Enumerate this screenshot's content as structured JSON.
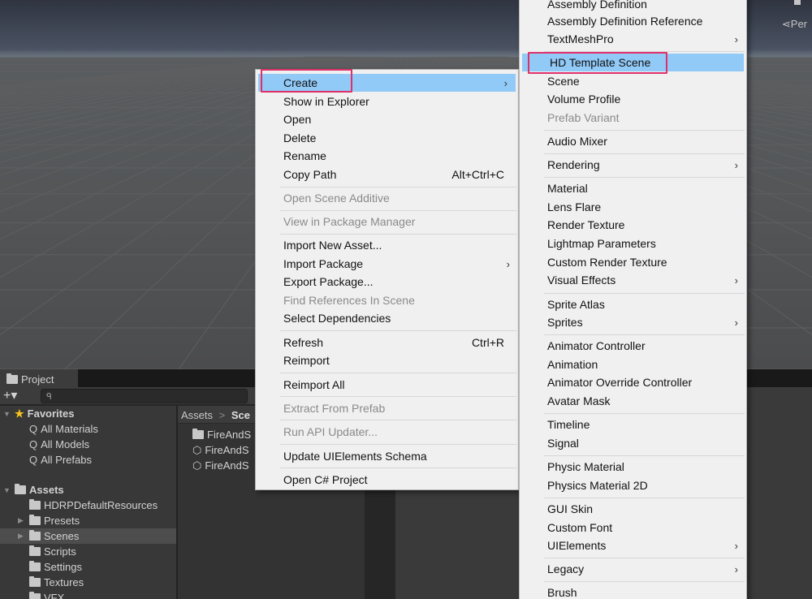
{
  "scene": {
    "persp_label": "⋖Per",
    "colors": {
      "sky": "#4a5262",
      "ground": "#4b4c4d",
      "grid": "#5e5f60"
    }
  },
  "project": {
    "tab_label": "Project",
    "add_button": "+▾",
    "search_placeholder": "",
    "favorites": {
      "label": "Favorites",
      "items": [
        "All Materials",
        "All Models",
        "All Prefabs"
      ]
    },
    "assets": {
      "label": "Assets",
      "items": [
        {
          "label": "HDRPDefaultResources",
          "expandable": false,
          "selected": false
        },
        {
          "label": "Presets",
          "expandable": true,
          "selected": false
        },
        {
          "label": "Scenes",
          "expandable": true,
          "selected": true
        },
        {
          "label": "Scripts",
          "expandable": false,
          "selected": false
        },
        {
          "label": "Settings",
          "expandable": false,
          "selected": false
        },
        {
          "label": "Textures",
          "expandable": false,
          "selected": false
        },
        {
          "label": "VFX",
          "expandable": false,
          "selected": false
        }
      ]
    },
    "breadcrumb": {
      "root": "Assets",
      "sep": ">",
      "current": "Sce"
    },
    "files": [
      {
        "icon": "folder-icon",
        "label": "FireAndS"
      },
      {
        "icon": "unity-scene-icon",
        "label": "FireAndS"
      },
      {
        "icon": "unity-scene-icon",
        "label": "FireAndS"
      }
    ]
  },
  "context_menu": {
    "items": [
      {
        "label": "Create",
        "highlighted": true,
        "submenu": true
      },
      {
        "label": "Show in Explorer"
      },
      {
        "label": "Open"
      },
      {
        "label": "Delete"
      },
      {
        "label": "Rename"
      },
      {
        "label": "Copy Path",
        "shortcut": "Alt+Ctrl+C"
      },
      {
        "label": "Open Scene Additive",
        "disabled": true
      },
      {
        "label": "View in Package Manager",
        "disabled": true
      },
      {
        "label": "Import New Asset..."
      },
      {
        "label": "Import Package",
        "submenu": true
      },
      {
        "label": "Export Package..."
      },
      {
        "label": "Find References In Scene",
        "disabled": true
      },
      {
        "label": "Select Dependencies"
      },
      {
        "label": "Refresh",
        "shortcut": "Ctrl+R"
      },
      {
        "label": "Reimport"
      },
      {
        "label": "Reimport All"
      },
      {
        "label": "Extract From Prefab",
        "disabled": true
      },
      {
        "label": "Run API Updater...",
        "disabled": true
      },
      {
        "label": "Update UIElements Schema"
      },
      {
        "label": "Open C# Project"
      }
    ]
  },
  "create_submenu": {
    "items": [
      {
        "label": "Assembly Definition"
      },
      {
        "label": "Assembly Definition Reference"
      },
      {
        "label": "TextMeshPro",
        "submenu": true
      },
      {
        "label": "HD Template Scene",
        "highlighted": true
      },
      {
        "label": "Scene"
      },
      {
        "label": "Volume Profile"
      },
      {
        "label": "Prefab Variant",
        "disabled": true
      },
      {
        "label": "Audio Mixer"
      },
      {
        "label": "Rendering",
        "submenu": true
      },
      {
        "label": "Material"
      },
      {
        "label": "Lens Flare"
      },
      {
        "label": "Render Texture"
      },
      {
        "label": "Lightmap Parameters"
      },
      {
        "label": "Custom Render Texture"
      },
      {
        "label": "Visual Effects",
        "submenu": true
      },
      {
        "label": "Sprite Atlas"
      },
      {
        "label": "Sprites",
        "submenu": true
      },
      {
        "label": "Animator Controller"
      },
      {
        "label": "Animation"
      },
      {
        "label": "Animator Override Controller"
      },
      {
        "label": "Avatar Mask"
      },
      {
        "label": "Timeline"
      },
      {
        "label": "Signal"
      },
      {
        "label": "Physic Material"
      },
      {
        "label": "Physics Material 2D"
      },
      {
        "label": "GUI Skin"
      },
      {
        "label": "Custom Font"
      },
      {
        "label": "UIElements",
        "submenu": true
      },
      {
        "label": "Legacy",
        "submenu": true
      },
      {
        "label": "Brush"
      }
    ]
  },
  "ui": {
    "chevron": "›",
    "star": "★",
    "search_glyph": "🔍",
    "expand_open": "▼",
    "expand_closed": "▶",
    "highlight_color": "#91c9f7",
    "annotation_color": "#e0306a"
  }
}
